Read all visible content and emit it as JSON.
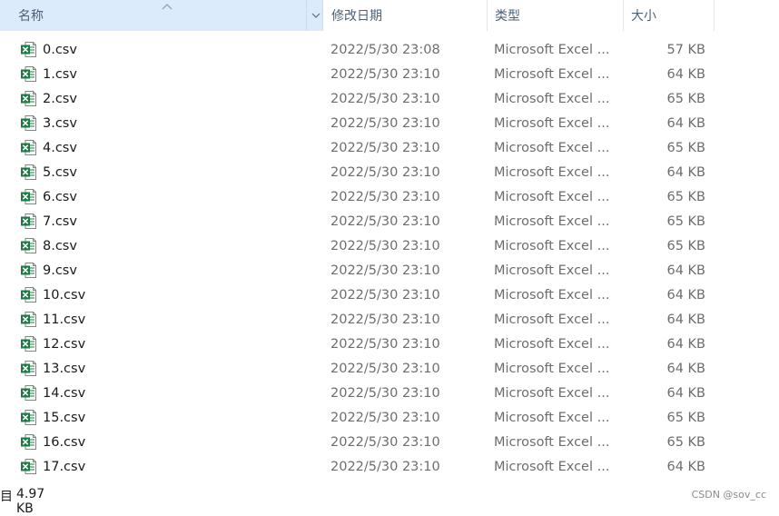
{
  "columns": {
    "name": "名称",
    "date": "修改日期",
    "type": "类型",
    "size": "大小"
  },
  "icons": {
    "file": "excel-csv-icon",
    "sort": "sort-ascending-icon",
    "dropdown": "chevron-down-icon"
  },
  "files": [
    {
      "name": "0.csv",
      "date": "2022/5/30 23:08",
      "type": "Microsoft Excel ...",
      "size": "57 KB"
    },
    {
      "name": "1.csv",
      "date": "2022/5/30 23:10",
      "type": "Microsoft Excel ...",
      "size": "64 KB"
    },
    {
      "name": "2.csv",
      "date": "2022/5/30 23:10",
      "type": "Microsoft Excel ...",
      "size": "65 KB"
    },
    {
      "name": "3.csv",
      "date": "2022/5/30 23:10",
      "type": "Microsoft Excel ...",
      "size": "64 KB"
    },
    {
      "name": "4.csv",
      "date": "2022/5/30 23:10",
      "type": "Microsoft Excel ...",
      "size": "65 KB"
    },
    {
      "name": "5.csv",
      "date": "2022/5/30 23:10",
      "type": "Microsoft Excel ...",
      "size": "64 KB"
    },
    {
      "name": "6.csv",
      "date": "2022/5/30 23:10",
      "type": "Microsoft Excel ...",
      "size": "65 KB"
    },
    {
      "name": "7.csv",
      "date": "2022/5/30 23:10",
      "type": "Microsoft Excel ...",
      "size": "65 KB"
    },
    {
      "name": "8.csv",
      "date": "2022/5/30 23:10",
      "type": "Microsoft Excel ...",
      "size": "65 KB"
    },
    {
      "name": "9.csv",
      "date": "2022/5/30 23:10",
      "type": "Microsoft Excel ...",
      "size": "64 KB"
    },
    {
      "name": "10.csv",
      "date": "2022/5/30 23:10",
      "type": "Microsoft Excel ...",
      "size": "64 KB"
    },
    {
      "name": "11.csv",
      "date": "2022/5/30 23:10",
      "type": "Microsoft Excel ...",
      "size": "64 KB"
    },
    {
      "name": "12.csv",
      "date": "2022/5/30 23:10",
      "type": "Microsoft Excel ...",
      "size": "64 KB"
    },
    {
      "name": "13.csv",
      "date": "2022/5/30 23:10",
      "type": "Microsoft Excel ...",
      "size": "64 KB"
    },
    {
      "name": "14.csv",
      "date": "2022/5/30 23:10",
      "type": "Microsoft Excel ...",
      "size": "64 KB"
    },
    {
      "name": "15.csv",
      "date": "2022/5/30 23:10",
      "type": "Microsoft Excel ...",
      "size": "65 KB"
    },
    {
      "name": "16.csv",
      "date": "2022/5/30 23:10",
      "type": "Microsoft Excel ...",
      "size": "65 KB"
    },
    {
      "name": "17.csv",
      "date": "2022/5/30 23:10",
      "type": "Microsoft Excel ...",
      "size": "64 KB"
    }
  ],
  "status": {
    "fragment": "目",
    "selection_size": "4.97 KB"
  },
  "watermark": "CSDN @sov_cc",
  "colors": {
    "header_selected_bg": "#dcebfb",
    "header_text": "#4c607a",
    "excel_green": "#1d7a45"
  }
}
